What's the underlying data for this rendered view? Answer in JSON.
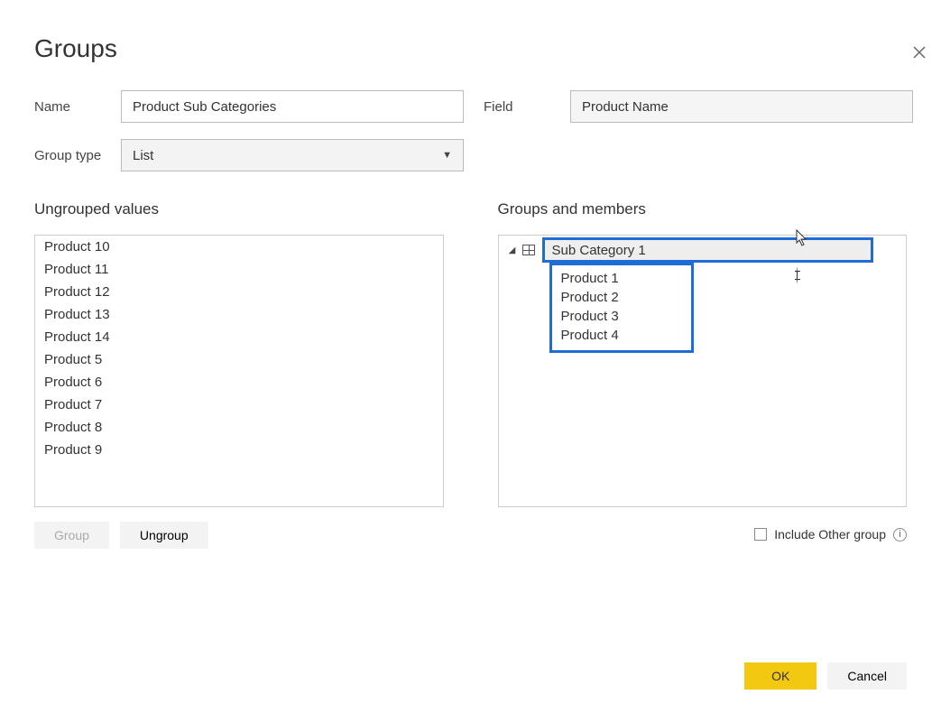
{
  "dialog": {
    "title": "Groups",
    "labels": {
      "name": "Name",
      "field": "Field",
      "groupType": "Group type",
      "ungroupedValues": "Ungrouped values",
      "groupsAndMembers": "Groups and members",
      "includeOther": "Include Other group"
    },
    "name_value": "Product Sub Categories",
    "field_value": "Product Name",
    "group_type_value": "List"
  },
  "ungrouped": [
    "Product 10",
    "Product 11",
    "Product 12",
    "Product 13",
    "Product 14",
    "Product 5",
    "Product 6",
    "Product 7",
    "Product 8",
    "Product 9"
  ],
  "group": {
    "name": "Sub Category 1",
    "members": [
      "Product 1",
      "Product 2",
      "Product 3",
      "Product 4"
    ]
  },
  "buttons": {
    "group": "Group",
    "ungroup": "Ungroup",
    "ok": "OK",
    "cancel": "Cancel"
  }
}
